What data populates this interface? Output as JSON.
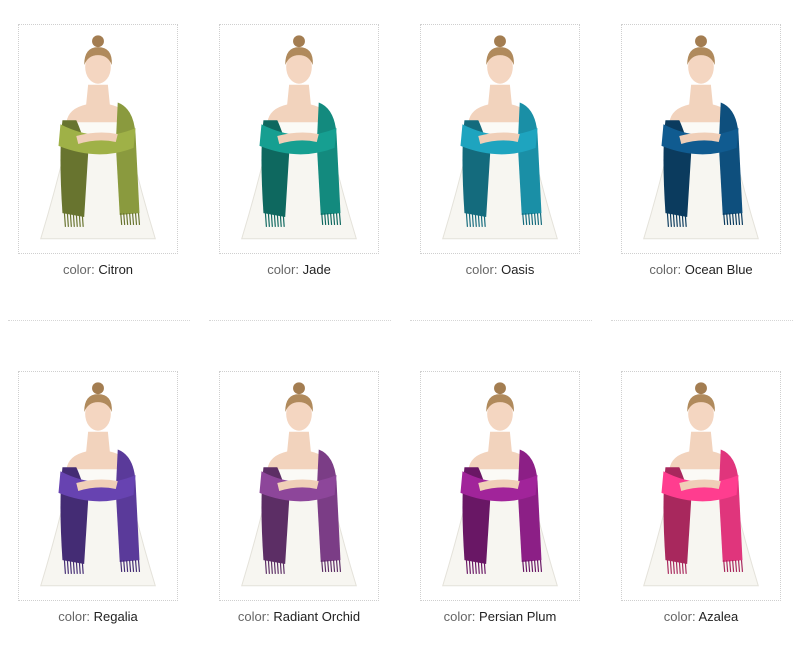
{
  "label_prefix": "color:",
  "swatches": [
    {
      "name": "Citron",
      "hex": "#8a9a3e"
    },
    {
      "name": "Jade",
      "hex": "#138a7e"
    },
    {
      "name": "Oasis",
      "hex": "#1a8fa6"
    },
    {
      "name": "Ocean Blue",
      "hex": "#0e4f7d"
    },
    {
      "name": "Regalia",
      "hex": "#5a3a9a"
    },
    {
      "name": "Radiant Orchid",
      "hex": "#7b3d86"
    },
    {
      "name": "Persian Plum",
      "hex": "#8c1f86"
    },
    {
      "name": "Azalea",
      "hex": "#e0357c"
    }
  ]
}
